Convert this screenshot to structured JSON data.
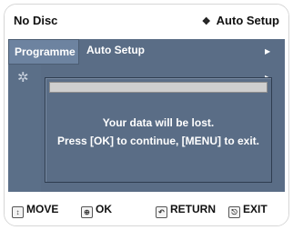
{
  "header": {
    "left_title": "No Disc",
    "right_title": "Auto Setup",
    "gear_glyph": "❖"
  },
  "menu": {
    "selected_label": "Programme",
    "row1_label": "Auto Setup"
  },
  "dialog": {
    "line1": "Your data will be lost.",
    "line2": "Press [OK] to continue, [MENU] to exit."
  },
  "footer": {
    "move": "MOVE",
    "ok": "OK",
    "return": "RETURN",
    "exit": "EXIT"
  },
  "icons": {
    "gear_icon": "gear-icon",
    "updown_icon": "up-down-icon",
    "ok_icon": "ok-icon",
    "return_icon": "return-icon",
    "exit_icon": "exit-icon"
  },
  "colors": {
    "panel": "#5a6d86",
    "selected_tile": "#6d83a0"
  }
}
